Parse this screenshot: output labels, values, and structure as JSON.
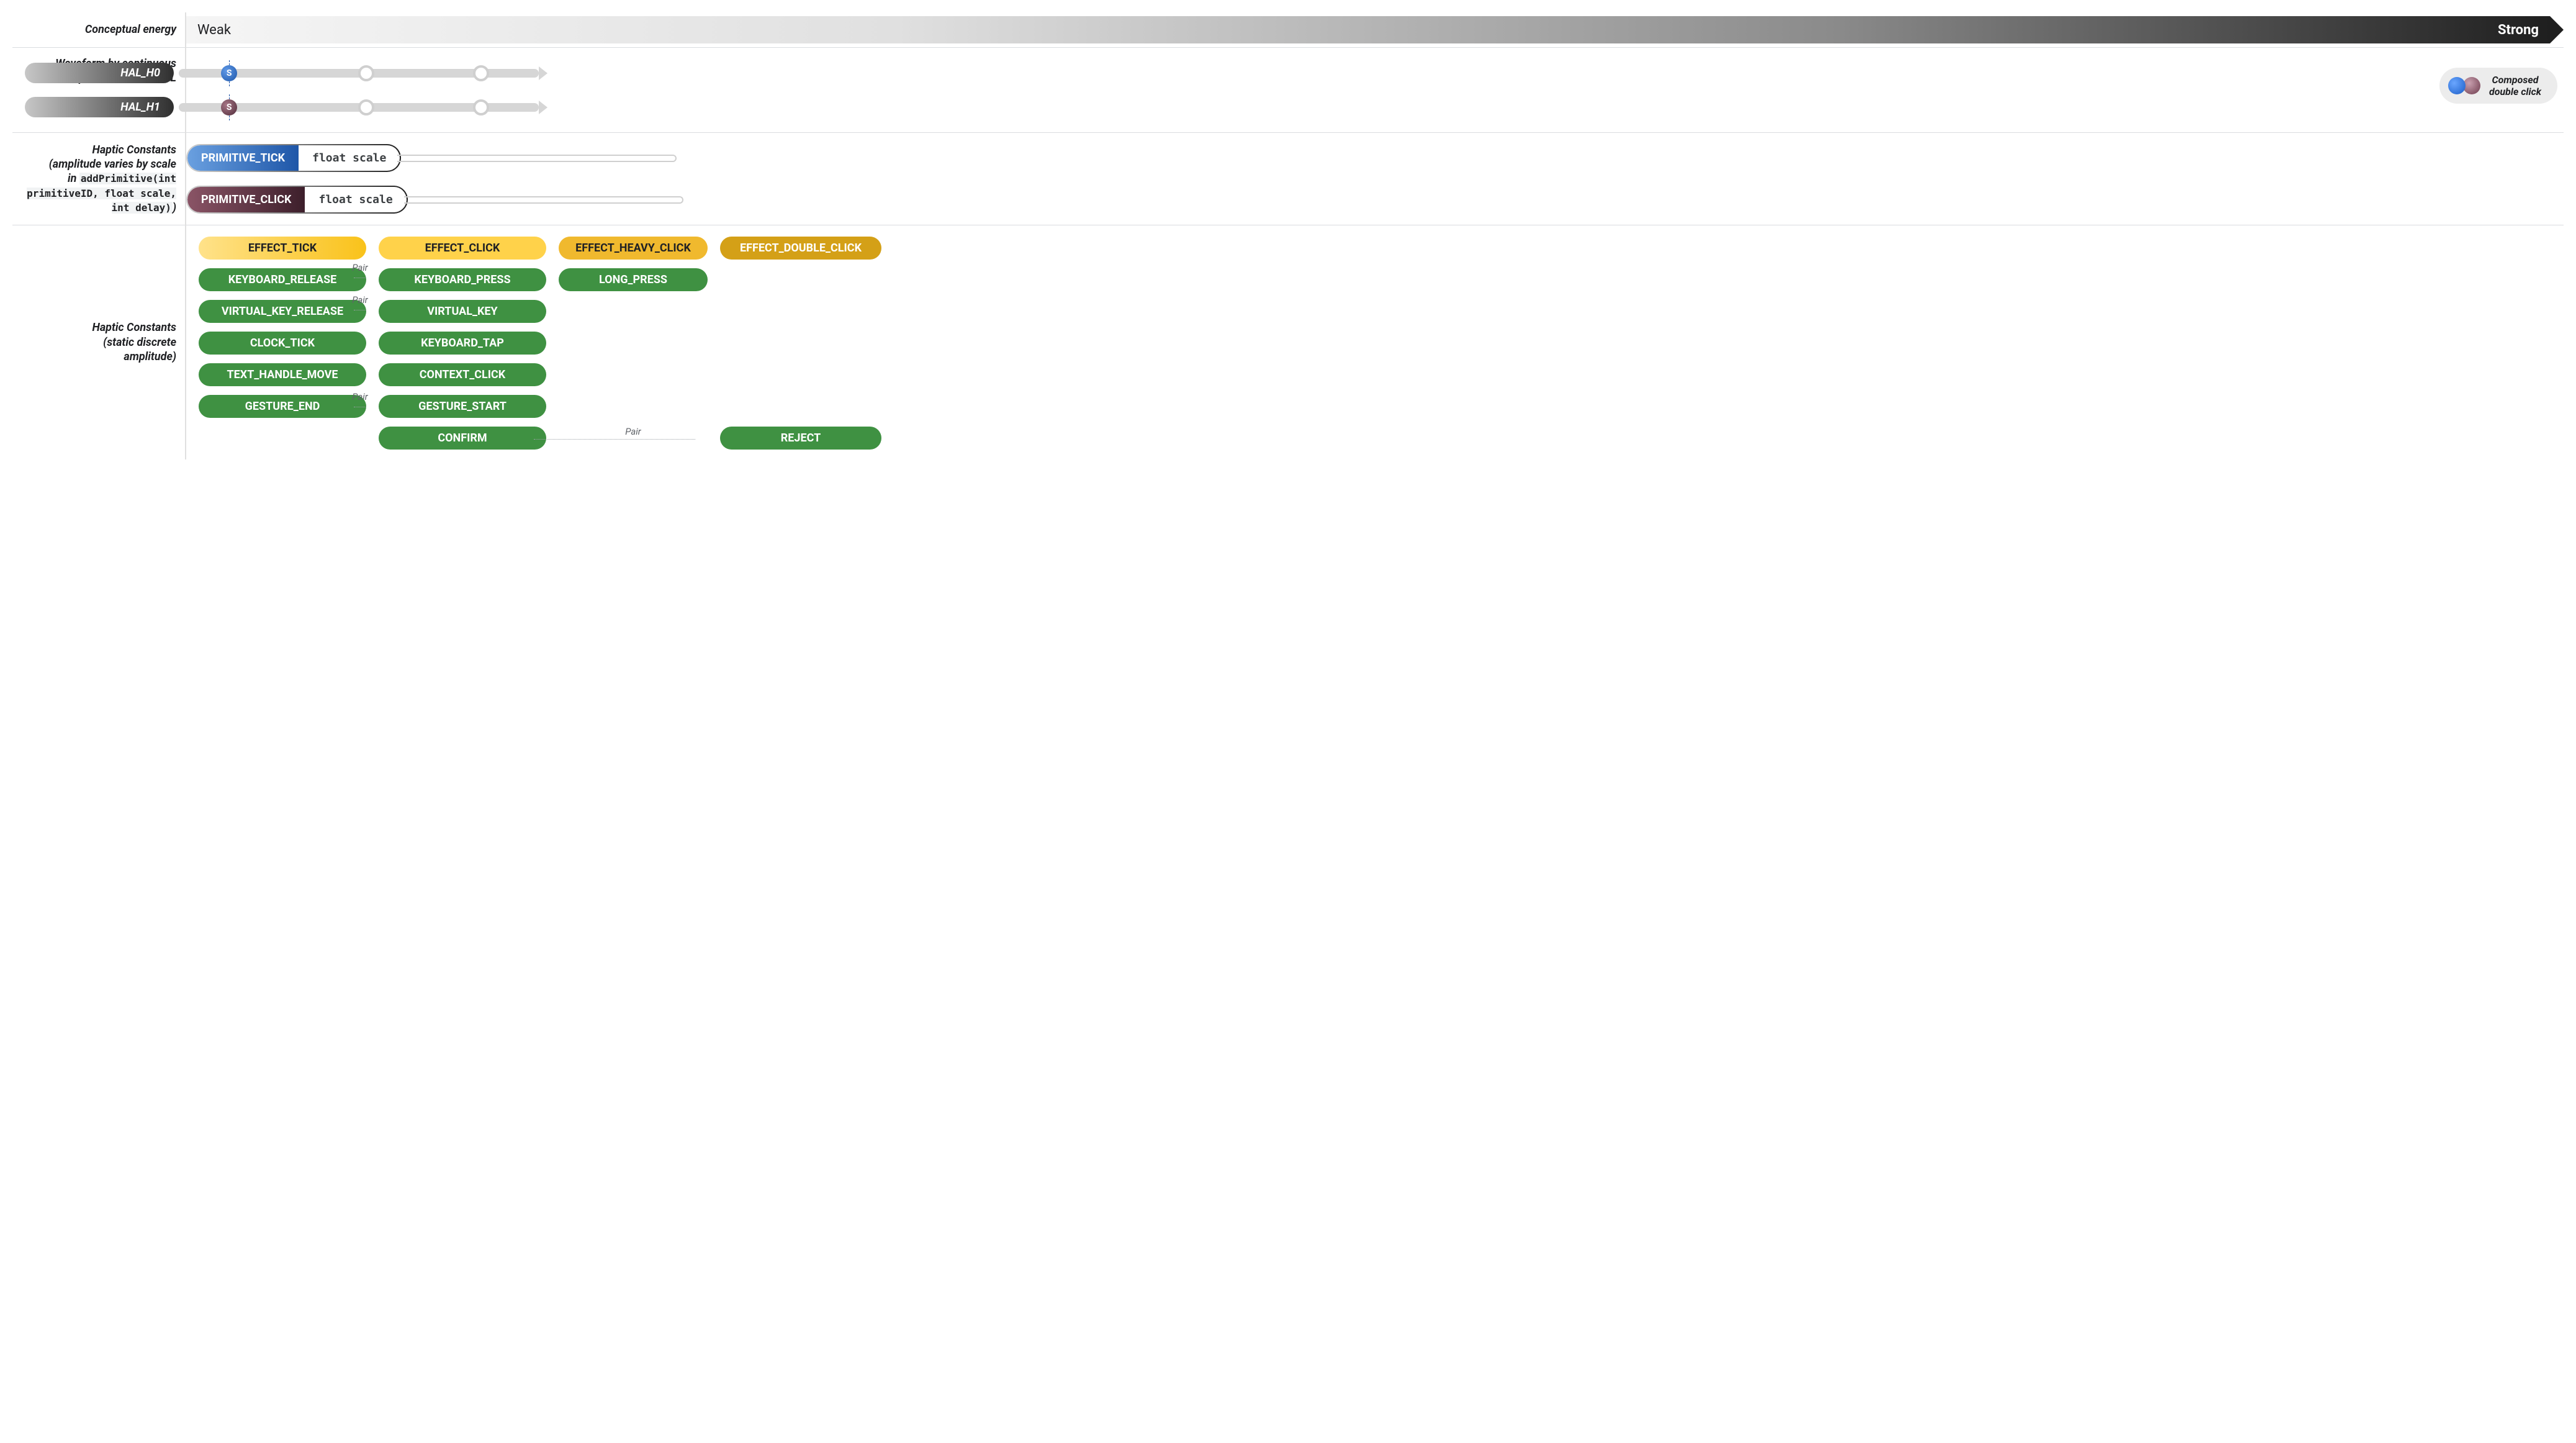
{
  "header": {
    "label": "Conceptual energy",
    "weak": "Weak",
    "strong": "Strong"
  },
  "hal": {
    "section_label_line1": "Waveform by continuous",
    "section_label_line2": "amplitude scale in HAL",
    "h0": "HAL_H0",
    "h1": "HAL_H1",
    "s_marker": "S",
    "composed_label_line1": "Composed",
    "composed_label_line2": "double click"
  },
  "primitives": {
    "label_line1": "Haptic Constants",
    "label_line2": "(amplitude varies by scale",
    "label_line3_prefix": "in ",
    "label_code": "addPrimitive(int primitiveID, float scale, int delay)",
    "label_line3_suffix": ")",
    "tick": "PRIMITIVE_TICK",
    "click": "PRIMITIVE_CLICK",
    "scale": "float scale"
  },
  "constants": {
    "label_line1": "Haptic Constants",
    "label_line2": "(static discrete",
    "label_line3": "amplitude)",
    "pair": "Pair",
    "effects": {
      "tick": "EFFECT_TICK",
      "click": "EFFECT_CLICK",
      "heavy": "EFFECT_HEAVY_CLICK",
      "double": "EFFECT_DOUBLE_CLICK"
    },
    "rows": {
      "keyboard_release": "KEYBOARD_RELEASE",
      "keyboard_press": "KEYBOARD_PRESS",
      "long_press": "LONG_PRESS",
      "virtual_key_release": "VIRTUAL_KEY_RELEASE",
      "virtual_key": "VIRTUAL_KEY",
      "clock_tick": "CLOCK_TICK",
      "keyboard_tap": "KEYBOARD_TAP",
      "text_handle_move": "TEXT_HANDLE_MOVE",
      "context_click": "CONTEXT_CLICK",
      "gesture_end": "GESTURE_END",
      "gesture_start": "GESTURE_START",
      "confirm": "CONFIRM",
      "reject": "REJECT"
    }
  },
  "colors": {
    "blue": "#2a6ac8",
    "maroon": "#6d3a4c",
    "green": "#3f9142",
    "yellow": "#ffd24a",
    "ochre": "#d4a017"
  }
}
